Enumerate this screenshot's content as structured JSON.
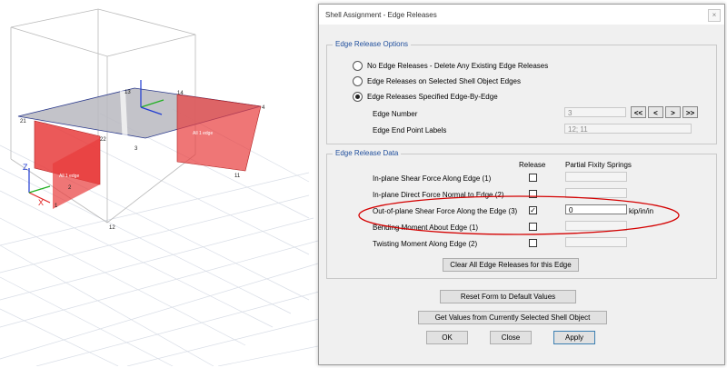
{
  "dialog": {
    "title": "Shell Assignment - Edge Releases",
    "close_glyph": "×"
  },
  "options": {
    "group_label": "Edge Release Options",
    "radio_none": "No Edge Releases - Delete Any Existing Edge Releases",
    "radio_selected": "Edge Releases on Selected Shell Object Edges",
    "radio_specified": "Edge Releases Specified Edge-By-Edge",
    "selected_radio": "radio_specified",
    "edge_number_label": "Edge Number",
    "edge_number_value": "3",
    "nav_first": "<<",
    "nav_prev": "<",
    "nav_next": ">",
    "nav_last": ">>",
    "edge_end_labels_label": "Edge End Point Labels",
    "edge_end_labels_value": "12; 11"
  },
  "release": {
    "group_label": "Edge Release Data",
    "col_release": "Release",
    "col_springs": "Partial Fixity Springs",
    "rows": [
      {
        "label": "In-plane Shear Force Along Edge (1)",
        "checked": false,
        "spring": "",
        "unit": ""
      },
      {
        "label": "In-plane Direct Force Normal to  Edge (2)",
        "checked": false,
        "spring": "",
        "unit": ""
      },
      {
        "label": "Out-of-plane Shear Force Along the Edge (3)",
        "checked": true,
        "spring": "0",
        "unit": "kip/in/in"
      },
      {
        "label": "Bending Moment About Edge (1)",
        "checked": false,
        "spring": "",
        "unit": ""
      },
      {
        "label": "Twisting Moment Along Edge (2)",
        "checked": false,
        "spring": "",
        "unit": ""
      }
    ],
    "check_mark": "✓",
    "clear_button": "Clear All Edge Releases for this Edge"
  },
  "buttons": {
    "reset": "Reset Form to Default Values",
    "get_values": "Get Values from Currently Selected Shell Object",
    "ok": "OK",
    "close": "Close",
    "apply": "Apply"
  },
  "model_view": {
    "point_labels": [
      "1",
      "2",
      "3",
      "4",
      "11",
      "12",
      "13",
      "14",
      "21",
      "22"
    ],
    "edge_labels": [
      "All 1 edge",
      "All 1 edge"
    ],
    "axis_labels": [
      "Z",
      "X"
    ],
    "highlight_color": "#e83c3c",
    "slab_color": "#b8b8c0",
    "annotation_color": "#d40000"
  }
}
